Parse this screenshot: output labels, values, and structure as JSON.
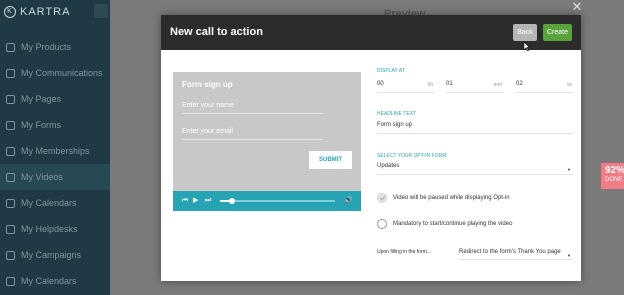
{
  "app": {
    "logo_text": "KARTRA",
    "nav": [
      {
        "label": "My Products"
      },
      {
        "label": "My Communications"
      },
      {
        "label": "My Pages"
      },
      {
        "label": "My Forms"
      },
      {
        "label": "My Memberships"
      },
      {
        "label": "My Videos"
      },
      {
        "label": "My Calendars"
      },
      {
        "label": "My Helpdesks"
      },
      {
        "label": "My Campaigns"
      },
      {
        "label": "My Calendars"
      }
    ],
    "preview_label": "Preview",
    "badge_percent": "92%",
    "badge_label": "DONE"
  },
  "modal": {
    "title": "New call to action",
    "back_label": "Back",
    "create_label": "Create"
  },
  "preview": {
    "form_title": "Form sign up",
    "name_placeholder": "Enter your name",
    "email_placeholder": "Enter your email",
    "submit_label": "SUBMIT",
    "progress": 0.1
  },
  "settings": {
    "display_at_label": "DISPLAY AT",
    "hh": "00",
    "hh_unit": "hh",
    "mm": "01",
    "mm_unit": "mm",
    "ss": "02",
    "ss_unit": "ss",
    "headline_label": "HEADLINE TEXT",
    "headline_value": "Form sign up",
    "optin_label": "SELECT YOUR OPT-IN FORM",
    "optin_value": "Updates",
    "pause_label": "Video will be paused while displaying Opt-in",
    "pause_checked": true,
    "mandatory_label": "Mandatory to start/continue playing the video",
    "mandatory_checked": false,
    "upon_label": "Upon filling in the form...",
    "upon_value": "Redirect to the form's Thank You page"
  }
}
